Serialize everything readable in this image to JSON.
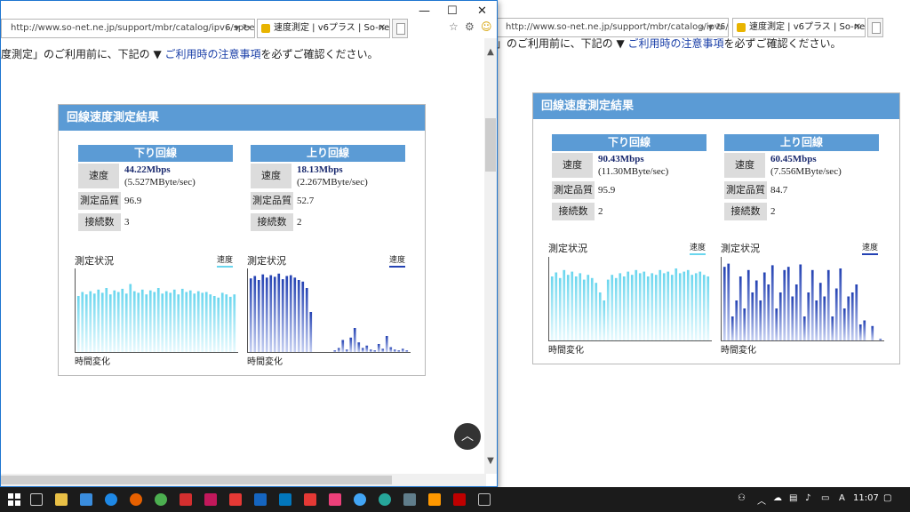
{
  "colors": {
    "accent": "#5b9bd5",
    "down_bar": "#6ad6ee",
    "up_bar": "#2442b3"
  },
  "browser": {
    "url": "http://www.so-net.ne.jp/support/mbr/catalog/ipv6/speedc",
    "tab_title": "速度測定 | v6プラス | So-net (..."
  },
  "page": {
    "notice_prefix": "度測定」のご利用前に、下記の ▼ ",
    "notice_link": "ご利用時の注意事項",
    "notice_suffix": "を必ずご確認ください。",
    "notice_prefix_right": "」のご利用前に、下記の ▼ "
  },
  "labels": {
    "panel_title": "回線速度測定結果",
    "down_header": "下り回線",
    "up_header": "上り回線",
    "speed": "速度",
    "quality": "測定品質",
    "connections": "接続数",
    "chart_title": "測定状況",
    "legend": "速度",
    "xlabel": "時間変化"
  },
  "results_left": {
    "down": {
      "mbps": "44.22Mbps",
      "mbyte": "(5.527MByte/sec)",
      "quality": "96.9",
      "connections": "3"
    },
    "up": {
      "mbps": "18.13Mbps",
      "mbyte": "(2.267MByte/sec)",
      "quality": "52.7",
      "connections": "2"
    }
  },
  "results_right": {
    "down": {
      "mbps": "90.43Mbps",
      "mbyte": "(11.30MByte/sec)",
      "quality": "95.9",
      "connections": "2"
    },
    "up": {
      "mbps": "60.45Mbps",
      "mbyte": "(7.556MByte/sec)",
      "quality": "84.7",
      "connections": "2"
    }
  },
  "chart_data": [
    {
      "type": "bar",
      "title": "測定状況",
      "xlabel": "時間変化",
      "series": [
        {
          "name": "速度",
          "values": [
            70,
            75,
            72,
            76,
            73,
            78,
            74,
            80,
            72,
            77,
            75,
            79,
            73,
            85,
            76,
            74,
            78,
            72,
            77,
            75,
            80,
            73,
            76,
            74,
            78,
            72,
            79,
            75,
            77,
            73,
            76,
            74,
            75,
            72,
            70,
            68,
            74,
            72,
            69,
            72
          ]
        }
      ],
      "ylim": [
        0,
        100
      ]
    },
    {
      "type": "bar",
      "title": "測定状況",
      "xlabel": "時間変化",
      "series": [
        {
          "name": "速度",
          "values": [
            92,
            95,
            90,
            97,
            93,
            96,
            94,
            98,
            91,
            95,
            96,
            93,
            90,
            88,
            80,
            50,
            0,
            0,
            0,
            0,
            0,
            2,
            5,
            15,
            3,
            18,
            30,
            12,
            5,
            8,
            3,
            2,
            10,
            4,
            20,
            6,
            3,
            2,
            4,
            2
          ]
        }
      ],
      "ylim": [
        0,
        100
      ]
    },
    {
      "type": "bar",
      "title": "測定状況",
      "xlabel": "時間変化",
      "series": [
        {
          "name": "速度",
          "values": [
            80,
            85,
            78,
            88,
            82,
            86,
            80,
            84,
            76,
            82,
            78,
            72,
            60,
            50,
            76,
            82,
            78,
            84,
            80,
            86,
            82,
            88,
            84,
            86,
            80,
            84,
            82,
            88,
            84,
            86,
            82,
            90,
            84,
            86,
            88,
            82,
            84,
            86,
            82,
            80
          ]
        }
      ],
      "ylim": [
        0,
        100
      ]
    },
    {
      "type": "bar",
      "title": "測定状況",
      "xlabel": "時間変化",
      "series": [
        {
          "name": "速度",
          "values": [
            92,
            96,
            30,
            50,
            80,
            40,
            88,
            60,
            75,
            50,
            85,
            70,
            94,
            40,
            60,
            88,
            92,
            55,
            70,
            95,
            30,
            60,
            88,
            50,
            72,
            55,
            88,
            30,
            65,
            90,
            40,
            55,
            60,
            70,
            20,
            25,
            0,
            18,
            0,
            2
          ]
        }
      ],
      "ylim": [
        0,
        100
      ]
    }
  ],
  "taskbar": {
    "time": "11:07",
    "lang": "A"
  }
}
